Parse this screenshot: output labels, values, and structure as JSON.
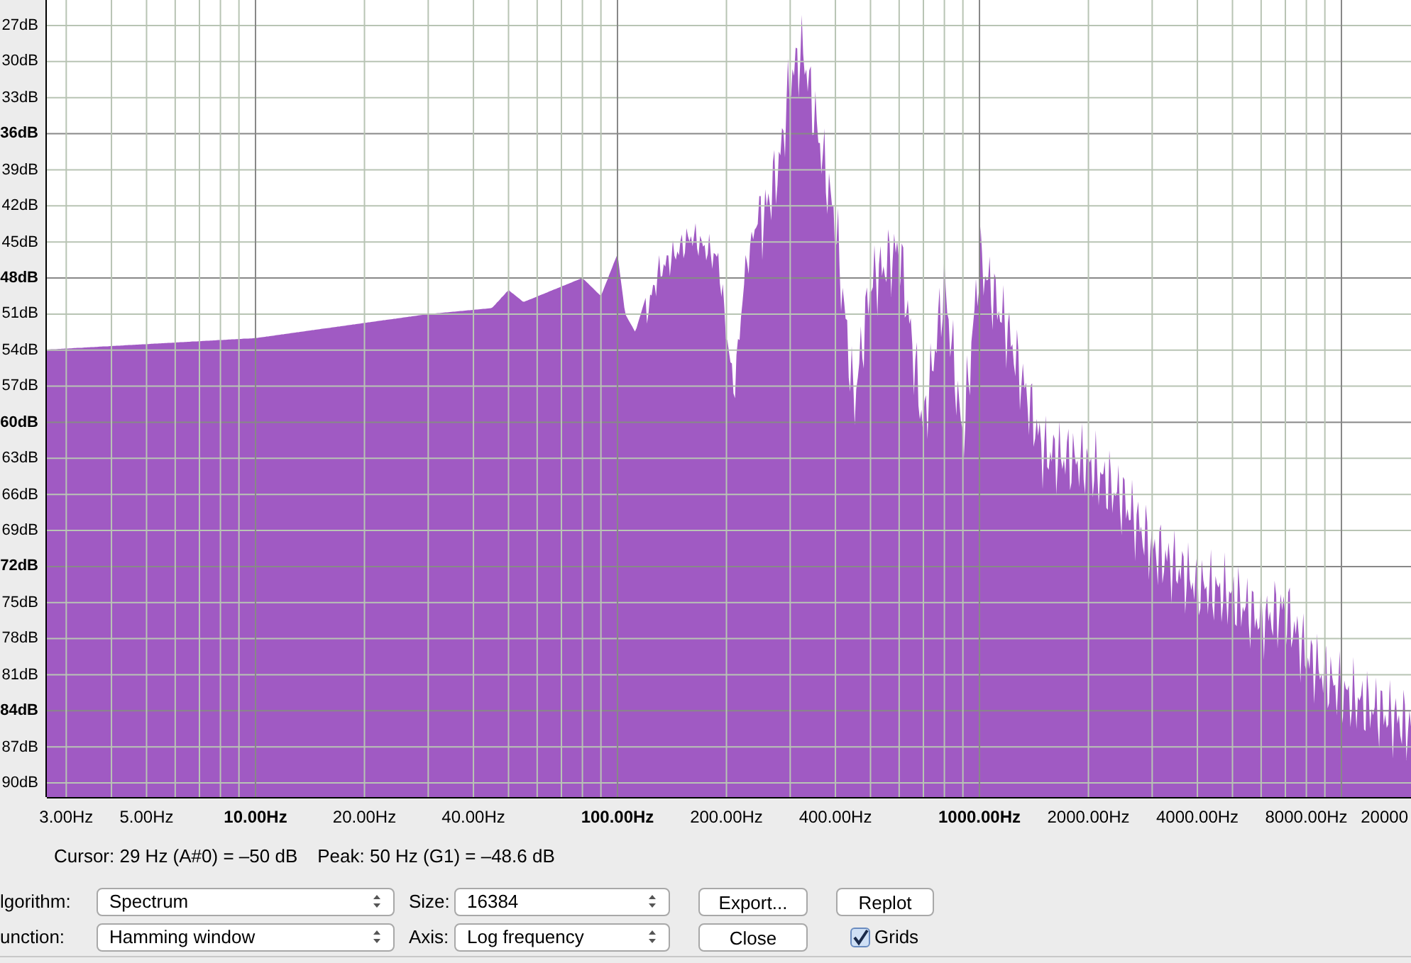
{
  "plot": {
    "y_labels": [
      {
        "text": "27dB",
        "bold": false
      },
      {
        "text": "30dB",
        "bold": false
      },
      {
        "text": "33dB",
        "bold": false
      },
      {
        "text": "36dB",
        "bold": true
      },
      {
        "text": "39dB",
        "bold": false
      },
      {
        "text": "42dB",
        "bold": false
      },
      {
        "text": "45dB",
        "bold": false
      },
      {
        "text": "48dB",
        "bold": true
      },
      {
        "text": "51dB",
        "bold": false
      },
      {
        "text": "54dB",
        "bold": false
      },
      {
        "text": "57dB",
        "bold": false
      },
      {
        "text": "60dB",
        "bold": true
      },
      {
        "text": "63dB",
        "bold": false
      },
      {
        "text": "66dB",
        "bold": false
      },
      {
        "text": "69dB",
        "bold": false
      },
      {
        "text": "72dB",
        "bold": true
      },
      {
        "text": "75dB",
        "bold": false
      },
      {
        "text": "78dB",
        "bold": false
      },
      {
        "text": "81dB",
        "bold": false
      },
      {
        "text": "84dB",
        "bold": true
      },
      {
        "text": "87dB",
        "bold": false
      },
      {
        "text": "90dB",
        "bold": false
      }
    ],
    "x_labels": [
      {
        "text": "3.00Hz",
        "bold": false
      },
      {
        "text": "5.00Hz",
        "bold": false
      },
      {
        "text": "10.00Hz",
        "bold": true
      },
      {
        "text": "20.00Hz",
        "bold": false
      },
      {
        "text": "40.00Hz",
        "bold": false
      },
      {
        "text": "100.00Hz",
        "bold": true
      },
      {
        "text": "200.00Hz",
        "bold": false
      },
      {
        "text": "400.00Hz",
        "bold": false
      },
      {
        "text": "1000.00Hz",
        "bold": true
      },
      {
        "text": "2000.00Hz",
        "bold": false
      },
      {
        "text": "4000.00Hz",
        "bold": false
      },
      {
        "text": "8000.00Hz",
        "bold": false
      },
      {
        "text": "20000",
        "bold": false
      }
    ]
  },
  "readout": {
    "cursor": "Cursor: 29 Hz (A#0) = –50 dB",
    "peak": "Peak: 50 Hz (G1) = –48.6 dB"
  },
  "fields": [
    {
      "label": "lgorithm:",
      "value": "Spectrum"
    },
    {
      "label": "Size:",
      "value": "16384"
    },
    {
      "label": "unction:",
      "value": "Hamming window"
    },
    {
      "label": "Axis:",
      "value": "Log frequency"
    }
  ],
  "buttons": [
    "Export...",
    "Replot",
    "Close"
  ],
  "grids": {
    "label": "Grids",
    "checked": true
  }
}
